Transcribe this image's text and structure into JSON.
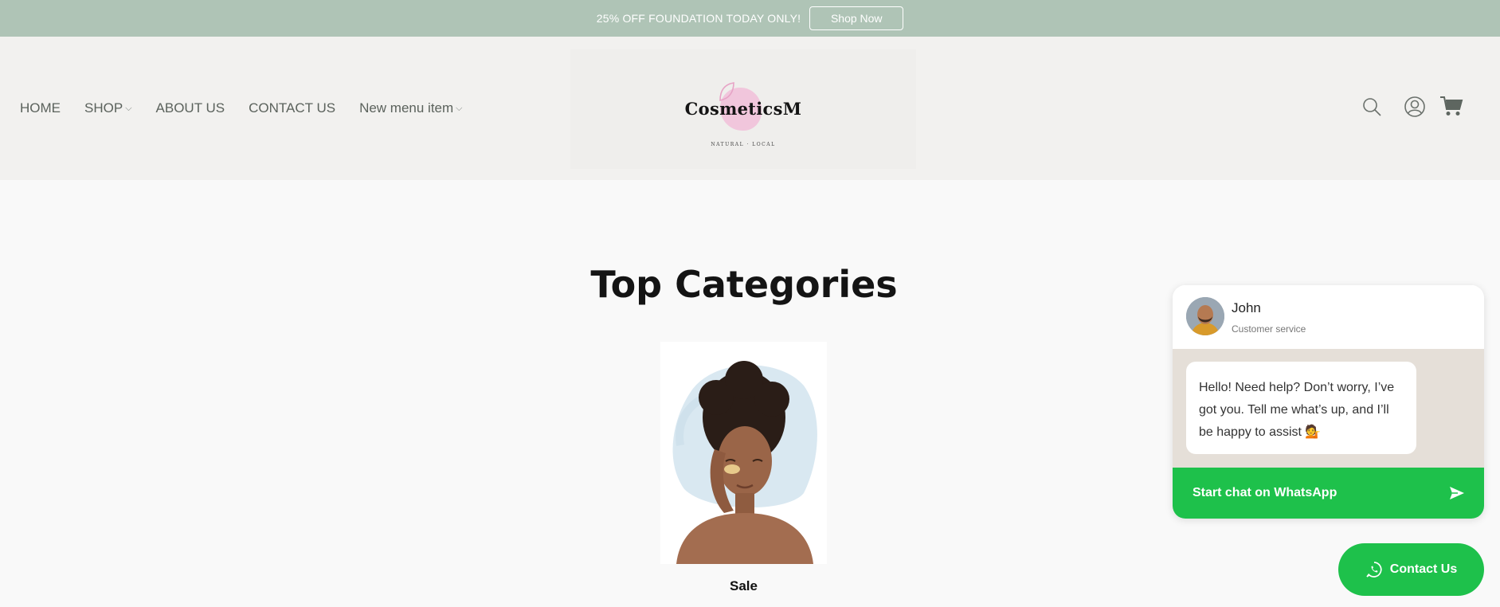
{
  "announcement": {
    "text": "25% OFF FOUNDATION TODAY ONLY!",
    "button": "Shop Now"
  },
  "nav": {
    "home": "HOME",
    "shop": "SHOP",
    "about": "ABOUT US",
    "contact": "CONTACT US",
    "new_item": "New menu item"
  },
  "logo": {
    "name": "CosmeticsM",
    "tagline": "NATURAL · LOCAL"
  },
  "icons": {
    "search": "search-icon",
    "account": "account-icon",
    "cart": "cart-icon"
  },
  "main": {
    "title": "Top Categories",
    "categories": [
      {
        "label": "Sale"
      }
    ]
  },
  "chat": {
    "agent_name": "John",
    "agent_role": "Customer service",
    "message": "Hello! Need help? Don’t worry, I’ve got you. Tell me what’s up, and I’ll be happy to assist 💁",
    "cta": "Start chat on WhatsApp"
  },
  "contact_button": "Contact Us",
  "colors": {
    "announcement_bg": "#afc4b6",
    "header_bg": "#f2f1ef",
    "whatsapp_green": "#1ec14b",
    "chat_body_bg": "#e5dfd8"
  }
}
